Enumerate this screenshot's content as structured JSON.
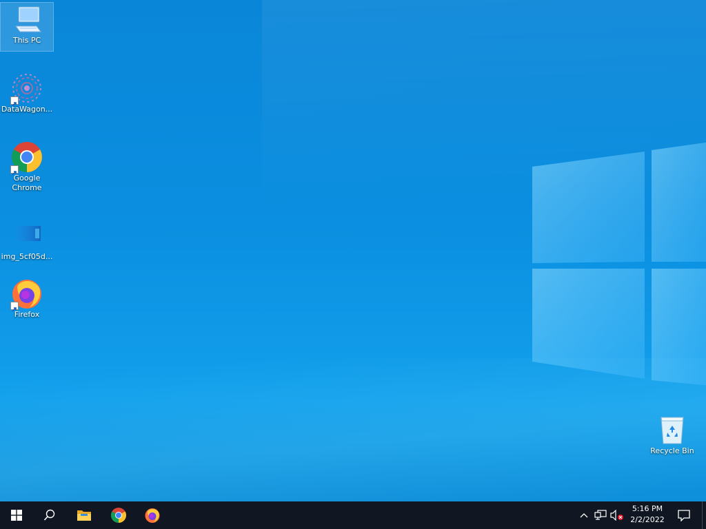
{
  "desktop": {
    "icons": [
      {
        "label": "This PC",
        "icon": "computer-icon",
        "selected": true
      },
      {
        "label": "DataWagon...",
        "icon": "datawagon-icon",
        "shortcut": true
      },
      {
        "label": "Google\nChrome",
        "icon": "chrome-icon",
        "shortcut": true
      },
      {
        "label": "img_5cf05d...",
        "icon": "image-file-icon"
      },
      {
        "label": "Firefox",
        "icon": "firefox-icon",
        "shortcut": true
      },
      {
        "label": "Recycle Bin",
        "icon": "recycle-bin-icon"
      }
    ]
  },
  "taskbar": {
    "start": "windows-start-icon",
    "search": "search-icon",
    "pinned": [
      "file-explorer-icon",
      "chrome-icon",
      "firefox-icon"
    ],
    "tray": [
      "chevron-up-icon",
      "network-icon",
      "volume-muted-icon"
    ],
    "time": "5:16 PM",
    "date": "2/2/2022",
    "notification": "action-center-icon"
  },
  "colors": {
    "wallpaper": "#0b8fe0",
    "taskbar": "#101722"
  }
}
